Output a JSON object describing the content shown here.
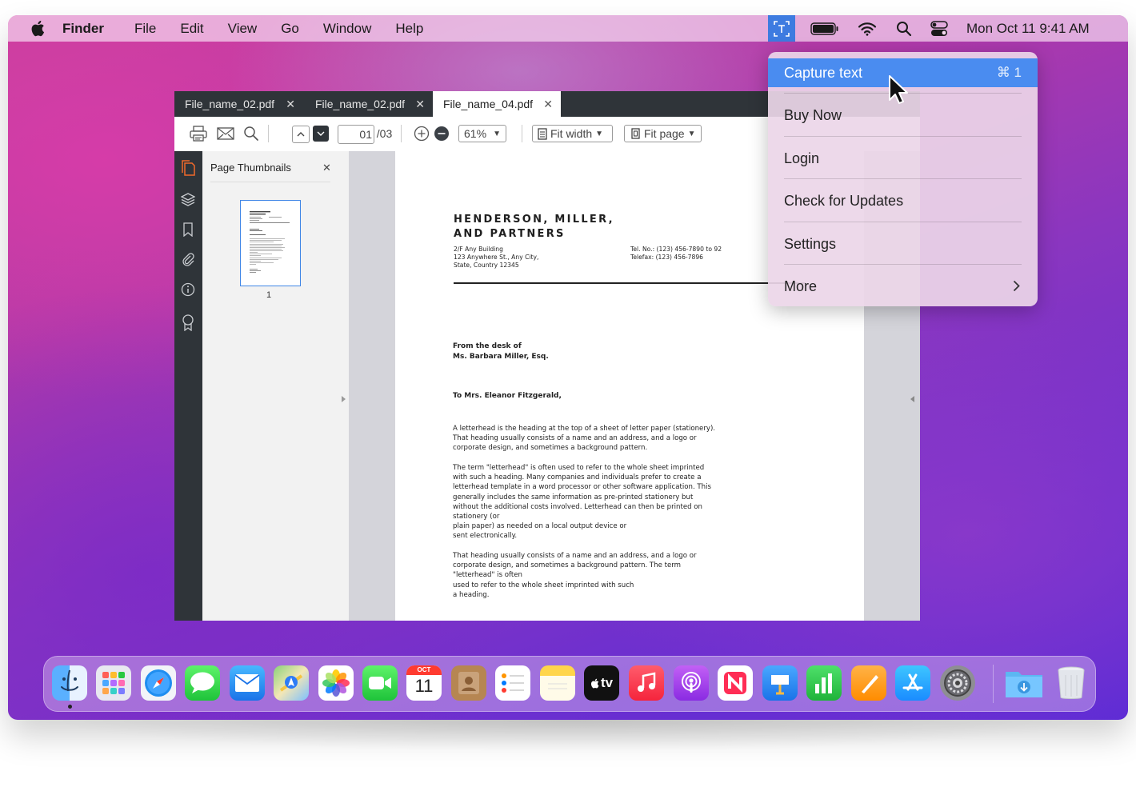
{
  "menubar": {
    "app_name": "Finder",
    "items": [
      "File",
      "Edit",
      "View",
      "Go",
      "Window",
      "Help"
    ],
    "datetime": "Mon Oct 11  9:41 AM"
  },
  "dropdown": {
    "items": [
      {
        "label": "Capture text",
        "shortcut": "⌘ 1",
        "active": true
      },
      {
        "label": "Buy Now"
      },
      {
        "label": "Login"
      },
      {
        "label": "Check for Updates"
      },
      {
        "label": "Settings"
      },
      {
        "label": "More",
        "submenu": true
      }
    ]
  },
  "viewer_window": {
    "tabs": [
      {
        "label": "File_name_02.pdf",
        "active": false
      },
      {
        "label": "File_name_02.pdf",
        "active": false
      },
      {
        "label": "File_name_04.pdf",
        "active": true
      }
    ],
    "toolbar": {
      "page_current": "01",
      "page_total": "/03",
      "zoom": "61%",
      "fit_width": "Fit width",
      "fit_page": "Fit page"
    },
    "thumbnails_panel": {
      "title": "Page Thumbnails",
      "thumb_label": "1"
    },
    "document": {
      "company_line1": "HENDERSON, MILLER,",
      "company_line2": "AND PARTNERS",
      "address_line1": "2/F Any Building",
      "address_line2": "123 Anywhere St., Any City,",
      "address_line3": "State, Country 12345",
      "tel": "Tel. No.: (123) 456-7890 to 92",
      "fax": "Telefax: (123) 456-7896",
      "from_line1": "From the desk of",
      "from_line2": "Ms. Barbara Miller, Esq.",
      "salutation": "To Mrs. Eleanor Fitzgerald,",
      "para1": [
        "A letterhead is the heading at the top of a sheet of letter paper (stationery).",
        "That heading usually consists of a name and an address, and a logo or",
        "corporate design, and sometimes a background pattern."
      ],
      "para2": [
        "The term \"letterhead\" is often used to refer to the whole sheet imprinted",
        "with such a heading. Many companies and individuals prefer to create a",
        "letterhead template in a word processor or other software application. This",
        "generally includes the same information as pre-printed stationery but",
        "without the additional costs involved. Letterhead can then be printed on",
        "stationery (or",
        "plain paper) as needed on a local output device or",
        "sent electronically."
      ],
      "para3": [
        "That heading usually consists of a name and an address, and a logo or",
        "corporate design, and sometimes a background pattern. The term",
        "\"letterhead\" is often",
        "used to refer to the whole sheet imprinted with such",
        "a heading."
      ]
    }
  },
  "dock": {
    "apps": [
      "finder-icon",
      "launchpad-icon",
      "safari-icon",
      "messages-icon",
      "mail-icon",
      "maps-icon",
      "photos-icon",
      "facetime-icon",
      "calendar-icon",
      "contacts-icon",
      "reminders-icon",
      "notes-icon",
      "apple-tv-icon",
      "music-icon",
      "podcasts-icon",
      "news-icon",
      "keynote-icon",
      "numbers-icon",
      "pages-icon",
      "app-store-icon",
      "system-preferences-icon",
      "downloads-folder-icon",
      "trash-icon"
    ],
    "calendar_month": "OCT",
    "calendar_day": "11",
    "tv_label": "tv"
  },
  "colors": {
    "menu_highlight": "#4a8cf0",
    "app_chrome": "#2f3439",
    "accent_orange": "#f06a2b"
  }
}
